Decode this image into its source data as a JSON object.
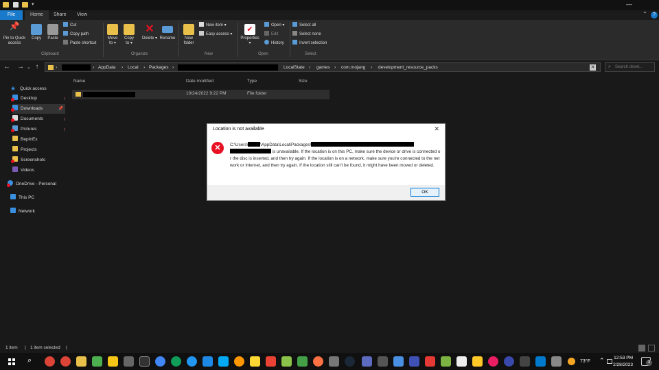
{
  "window": {
    "tabs": [
      "File",
      "Home",
      "Share",
      "View"
    ],
    "active_tab": "Home"
  },
  "ribbon": {
    "clipboard": {
      "pin_label": "Pin to Quick access",
      "copy_label": "Copy",
      "paste_label": "Paste",
      "cut_label": "Cut",
      "copy_path_label": "Copy path",
      "paste_shortcut_label": "Paste shortcut",
      "group_label": "Clipboard"
    },
    "organize": {
      "move_label": "Move to ▾",
      "copy_label": "Copy to ▾",
      "delete_label": "Delete ▾",
      "rename_label": "Rename",
      "group_label": "Organize"
    },
    "new": {
      "new_folder_label": "New folder",
      "new_item_label": "New item ▾",
      "easy_access_label": "Easy access ▾",
      "group_label": "New"
    },
    "open": {
      "properties_label": "Properties ▾",
      "open_label": "Open ▾",
      "edit_label": "Edit",
      "history_label": "History",
      "group_label": "Open"
    },
    "select": {
      "select_all_label": "Select all",
      "select_none_label": "Select none",
      "invert_label": "Invert selection",
      "group_label": "Select"
    }
  },
  "address": {
    "crumbs": [
      "AppData",
      "Local",
      "Packages",
      "LocalState",
      "games",
      "com.mojang",
      "development_resource_packs"
    ],
    "search_placeholder": "Search devel..."
  },
  "sidebar": {
    "items": [
      {
        "label": "Quick access",
        "icon": "star-icon"
      },
      {
        "label": "Desktop",
        "icon": "desktop-icon"
      },
      {
        "label": "Downloads",
        "icon": "download-icon"
      },
      {
        "label": "Documents",
        "icon": "documents-icon"
      },
      {
        "label": "Pictures",
        "icon": "pictures-icon"
      },
      {
        "label": "BepInEx",
        "icon": "folder-icon"
      },
      {
        "label": "Projects",
        "icon": "folder-icon"
      },
      {
        "label": "Screenshots",
        "icon": "folder-icon"
      },
      {
        "label": "Videos",
        "icon": "videos-icon"
      },
      {
        "label": "OneDrive - Personal",
        "icon": "cloud-icon"
      },
      {
        "label": "This PC",
        "icon": "computer-icon"
      },
      {
        "label": "Network",
        "icon": "network-icon"
      }
    ]
  },
  "file_list": {
    "columns": [
      "Name",
      "Date modified",
      "Type",
      "Size"
    ],
    "rows": [
      {
        "name": "",
        "date": "10/24/2022 9:22 PM",
        "type": "File folder",
        "size": ""
      }
    ]
  },
  "status": {
    "items_count": "1 item",
    "selected": "1 item selected"
  },
  "dialog": {
    "title": "Location is not available",
    "path_prefix": "C:\\Users\\",
    "path_mid": "\\AppData\\Local\\Packages\\",
    "message": " is unavailable. If the location is on this PC, make sure the device or drive is connected or the disc is inserted, and then try again. If the location is on a network, make sure you're connected to the network or Internet, and then try again. If the location still can't be found, it might have been moved or deleted.",
    "ok_label": "OK"
  },
  "taskbar": {
    "weather": "73°F",
    "time": "12:53 PM",
    "date": "2/28/2023",
    "notifications": "3"
  },
  "colors": {
    "accent": "#0078d7",
    "error": "#e81123",
    "folder": "#e8c04a"
  }
}
